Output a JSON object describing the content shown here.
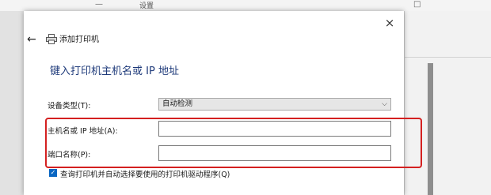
{
  "background_window": {
    "title": "设置",
    "min_glyph": "—",
    "max_glyph": "□"
  },
  "dialog": {
    "title": "添加打印机",
    "heading": "键入打印机主机名或 IP 地址",
    "close_glyph": "×",
    "back_glyph": "←",
    "device_type": {
      "label": "设备类型(T):",
      "value": "自动检测",
      "chevron": "⌵"
    },
    "hostname": {
      "label": "主机名或 IP 地址(A):",
      "value": ""
    },
    "port_name": {
      "label": "端口名称(P):",
      "value": ""
    },
    "query_checkbox": {
      "label": "查询打印机并自动选择要使用的打印机驱动程序(Q)",
      "checked": true,
      "check_glyph": "✓"
    }
  },
  "colors": {
    "heading": "#1e3a7a",
    "highlight_border": "#d42020",
    "checkbox_fill": "#0a66c2"
  }
}
